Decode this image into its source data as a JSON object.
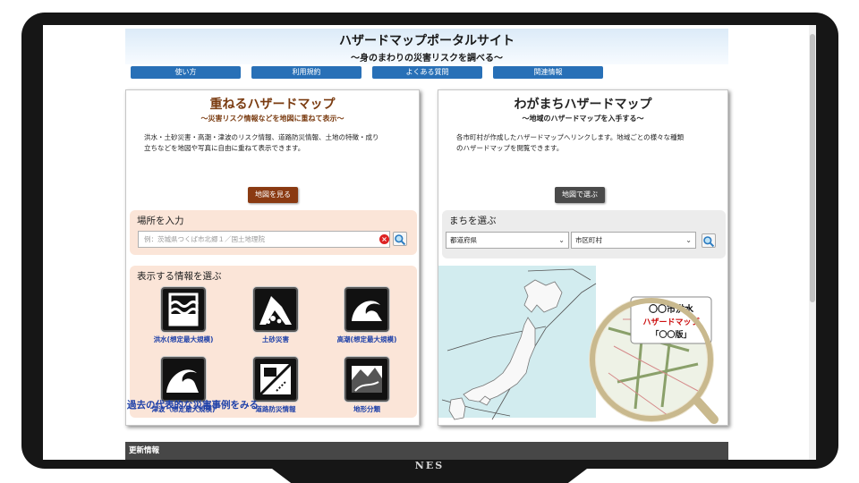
{
  "header": {
    "title": "ハザードマップポータルサイト",
    "subtitle": "〜身のまわりの災害リスクを調べる〜"
  },
  "nav": {
    "items": [
      "使い方",
      "利用規約",
      "よくある質問",
      "関連情報"
    ]
  },
  "left_panel": {
    "title": "重ねるハザードマップ",
    "subtitle": "〜災害リスク情報などを地図に重ねて表示〜",
    "desc_line1": "洪水・土砂災害・高潮・津波のリスク情報、道路防災情報、土地の特徴・成り",
    "desc_line2": "立ちなどを地図や写真に自由に重ねて表示できます。",
    "map_button": "地図を見る",
    "search": {
      "label": "場所を入力",
      "placeholder": "例：茨城県つくば市北郷１／国土地理院"
    },
    "info": {
      "label": "表示する情報を選ぶ",
      "tiles": [
        "洪水(想定最大規模)",
        "土砂災害",
        "高潮(想定最大規模)",
        "津波（想定最大規模)",
        "道路防災情報",
        "地形分類"
      ]
    },
    "examples_link": "過去の代表的な災害事例をみる"
  },
  "right_panel": {
    "title": "わがまちハザードマップ",
    "subtitle": "〜地域のハザードマップを入手する〜",
    "desc_line1": "各市町村が作成したハザードマップへリンクします。地域ごとの様々な種類",
    "desc_line2": "のハザードマップを閲覧できます。",
    "map_button": "地図で選ぶ",
    "town": {
      "label": "まちを選ぶ",
      "prefecture": "都道府県",
      "city": "市区町村"
    },
    "magnifier_text_line1": "〇〇市洪水",
    "magnifier_text_line2": "ハザードマップ",
    "magnifier_text_line3": "「〇〇版」"
  },
  "updates": {
    "label": "更新情報"
  },
  "brand": "NES",
  "colors": {
    "nav_blue": "#2870b7",
    "left_title": "#7a3b10",
    "left_button": "#8a3a12",
    "left_box": "#fbe5d8",
    "right_button": "#4a4a4a",
    "right_box": "#ececec",
    "link_blue": "#1c3fa8",
    "sea": "#d2ecef"
  },
  "icons": [
    "search-icon",
    "clear-icon",
    "chevron-down-icon",
    "flood-icon",
    "landslide-icon",
    "storm-surge-icon",
    "tsunami-icon",
    "road-hazard-icon",
    "landform-icon",
    "magnifier-icon"
  ]
}
